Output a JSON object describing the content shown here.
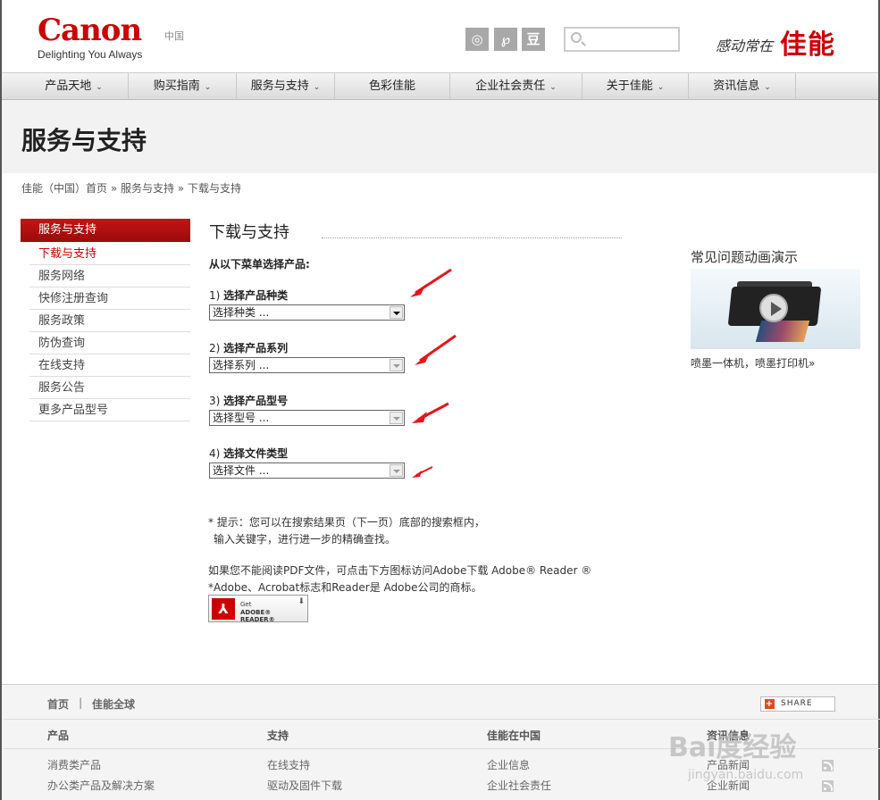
{
  "header": {
    "logo": "Canon",
    "tagline": "Delighting You Always",
    "region": "中国",
    "social": [
      {
        "icon": "weibo-icon",
        "glyph": "◎"
      },
      {
        "icon": "qq-weibo-icon",
        "glyph": "℘"
      },
      {
        "icon": "douban-icon",
        "glyph": "豆"
      }
    ],
    "search_placeholder": "",
    "slogan": "感动常在",
    "brand_cn": "佳能"
  },
  "nav": [
    {
      "label": "产品天地",
      "chev": "⌄"
    },
    {
      "label": "购买指南",
      "chev": "⌄"
    },
    {
      "label": "服务与支持",
      "chev": "⌄"
    },
    {
      "label": "色彩佳能",
      "chev": ""
    },
    {
      "label": "企业社会责任",
      "chev": "⌄"
    },
    {
      "label": "关于佳能",
      "chev": "⌄"
    },
    {
      "label": "资讯信息",
      "chev": "⌄"
    }
  ],
  "page_title": "服务与支持",
  "breadcrumb": "佳能（中国）首页 » 服务与支持 » 下载与支持",
  "sidebar": {
    "head": "服务与支持",
    "items": [
      "下载与支持",
      "服务网络",
      "快修注册查询",
      "服务政策",
      "防伪查询",
      "在线支持",
      "服务公告",
      "更多产品型号"
    ]
  },
  "main": {
    "title": "下载与支持",
    "intro": "从以下菜单选择产品:",
    "steps": [
      {
        "num": "1)",
        "label": "选择产品种类",
        "value": "选择种类 ..."
      },
      {
        "num": "2)",
        "label": "选择产品系列",
        "value": "选择系列 ..."
      },
      {
        "num": "3)",
        "label": "选择产品型号",
        "value": "选择型号 ..."
      },
      {
        "num": "4)",
        "label": "选择文件类型",
        "value": "选择文件 ..."
      }
    ],
    "tip1": "* 提示：您可以在搜索结果页（下一页）底部的搜索框内，",
    "tip2": "输入关键字，进行进一步的精确查找。",
    "pdf1": "如果您不能阅读PDF文件，可点击下方图标访问Adobe下载 Adobe® Reader ®",
    "pdf2": "*Adobe、Acrobat标志和Reader是 Adobe公司的商标。",
    "adobe_get": "Get",
    "adobe_reader": "ADOBE® READER®",
    "arrow_color": "#e8141c"
  },
  "right": {
    "title": "常见问题动画演示",
    "caption": "喷墨一体机，喷墨打印机»"
  },
  "footer": {
    "home": "首页",
    "sep": "|",
    "global": "佳能全球",
    "share": "SHARE",
    "cols": [
      {
        "head": "产品",
        "items": [
          "消费类产品",
          "办公类产品及解决方案"
        ]
      },
      {
        "head": "支持",
        "items": [
          "在线支持",
          "驱动及固件下载"
        ]
      },
      {
        "head": "佳能在中国",
        "items": [
          "企业信息",
          "企业社会责任"
        ]
      },
      {
        "head": "资讯信息",
        "items": [
          "产品新闻",
          "企业新闻"
        ]
      }
    ],
    "watermark": "Bai度经验",
    "watermark_url": "jingyan.baidu.com"
  }
}
